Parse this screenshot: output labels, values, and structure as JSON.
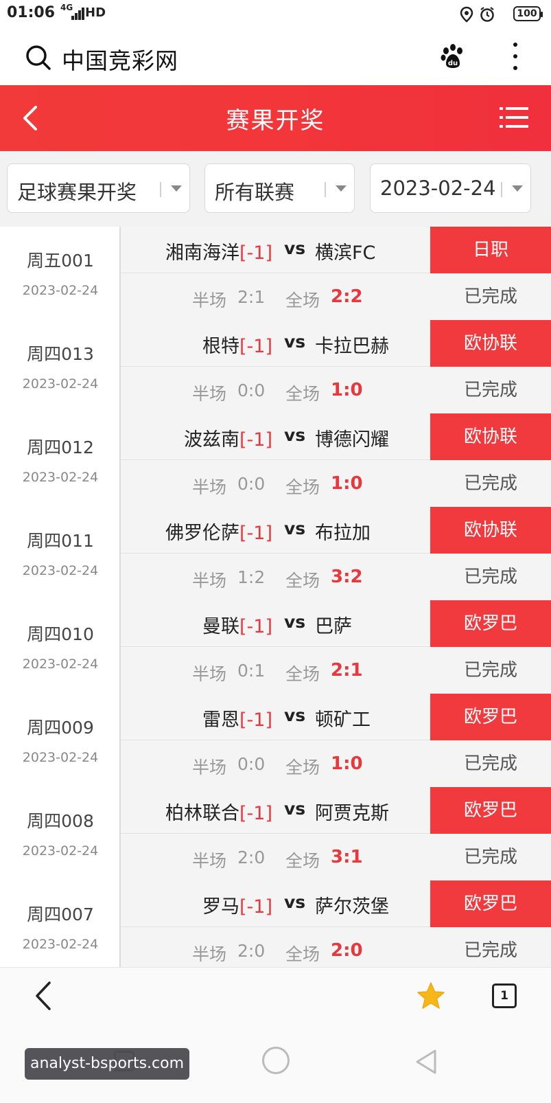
{
  "status_bar": {
    "time": "01:06",
    "network": "4G",
    "hd": "HD",
    "battery": "100"
  },
  "browser": {
    "site_name": "中国竞彩网"
  },
  "header": {
    "title": "赛果开奖"
  },
  "filters": [
    {
      "label": "足球赛果开奖"
    },
    {
      "label": "所有联赛"
    },
    {
      "label": "2023-02-24"
    }
  ],
  "score_labels": {
    "half": "半场",
    "full": "全场",
    "vs": "vs"
  },
  "matches": [
    {
      "code": "周五001",
      "date": "2023-02-24",
      "home": "湘南海洋",
      "handicap": "[-1]",
      "away": "横滨FC",
      "half": "2:1",
      "full": "2:2",
      "league": "日职",
      "status": "已完成"
    },
    {
      "code": "周四013",
      "date": "2023-02-24",
      "home": "根特",
      "handicap": "[-1]",
      "away": "卡拉巴赫",
      "half": "0:0",
      "full": "1:0",
      "league": "欧协联",
      "status": "已完成"
    },
    {
      "code": "周四012",
      "date": "2023-02-24",
      "home": "波兹南",
      "handicap": "[-1]",
      "away": "博德闪耀",
      "half": "0:0",
      "full": "1:0",
      "league": "欧协联",
      "status": "已完成"
    },
    {
      "code": "周四011",
      "date": "2023-02-24",
      "home": "佛罗伦萨",
      "handicap": "[-1]",
      "away": "布拉加",
      "half": "1:2",
      "full": "3:2",
      "league": "欧协联",
      "status": "已完成"
    },
    {
      "code": "周四010",
      "date": "2023-02-24",
      "home": "曼联",
      "handicap": "[-1]",
      "away": "巴萨",
      "half": "0:1",
      "full": "2:1",
      "league": "欧罗巴",
      "status": "已完成"
    },
    {
      "code": "周四009",
      "date": "2023-02-24",
      "home": "雷恩",
      "handicap": "[-1]",
      "away": "顿矿工",
      "half": "0:0",
      "full": "1:0",
      "league": "欧罗巴",
      "status": "已完成"
    },
    {
      "code": "周四008",
      "date": "2023-02-24",
      "home": "柏林联合",
      "handicap": "[-1]",
      "away": "阿贾克斯",
      "half": "2:0",
      "full": "3:1",
      "league": "欧罗巴",
      "status": "已完成"
    },
    {
      "code": "周四007",
      "date": "2023-02-24",
      "home": "罗马",
      "handicap": "[-1]",
      "away": "萨尔茨堡",
      "half": "2:0",
      "full": "2:0",
      "league": "欧罗巴",
      "status": "已完成"
    }
  ],
  "bottom_bar": {
    "tab_count": "1"
  },
  "watermark": "analyst-bsports.com",
  "colors": {
    "accent": "#f03a3d",
    "score": "#e8383d"
  },
  "icons": [
    "search-icon",
    "paw-icon",
    "more-icon",
    "back-icon",
    "menu-icon",
    "dropdown-arrow-icon",
    "star-icon",
    "tabs-icon"
  ]
}
